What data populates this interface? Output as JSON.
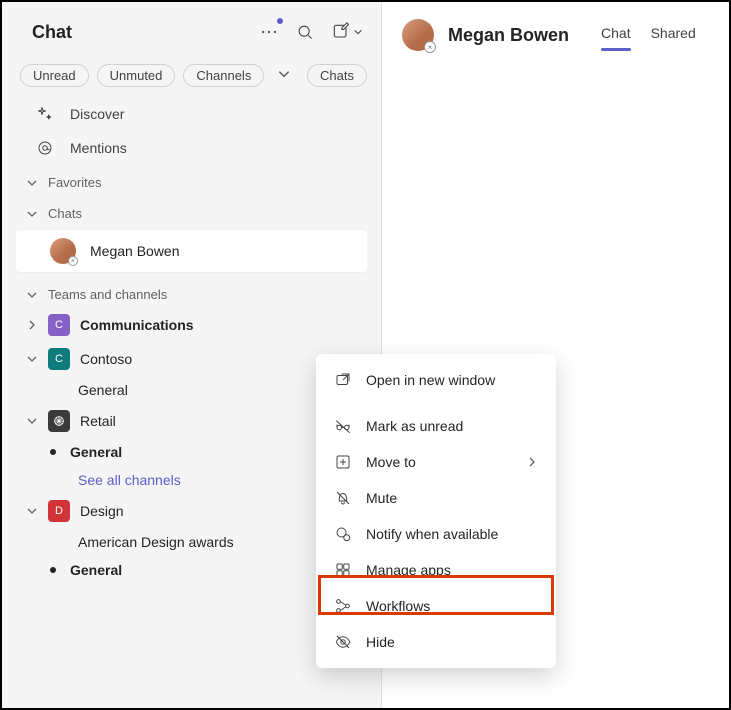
{
  "sidebar": {
    "title": "Chat",
    "filters": [
      "Unread",
      "Unmuted",
      "Channels",
      "Chats"
    ],
    "nav": [
      {
        "label": "Discover",
        "icon": "sparkle-icon"
      },
      {
        "label": "Mentions",
        "icon": "at-icon"
      }
    ],
    "sections": {
      "favorites": "Favorites",
      "chats": "Chats",
      "teams": "Teams and channels"
    },
    "active_chat": {
      "name": "Megan Bowen"
    },
    "teams": [
      {
        "name": "Communications",
        "color": "purple",
        "letter": "C",
        "expanded": false,
        "bold": true
      },
      {
        "name": "Contoso",
        "color": "teal",
        "letter": "C",
        "expanded": true,
        "channels": [
          {
            "label": "General",
            "bold": false,
            "bullet": false
          }
        ]
      },
      {
        "name": "Retail",
        "color": "dark",
        "letter": "",
        "expanded": true,
        "channels": [
          {
            "label": "General",
            "bold": true,
            "bullet": true
          },
          {
            "label": "See all channels",
            "link": true
          }
        ]
      },
      {
        "name": "Design",
        "color": "red",
        "letter": "D",
        "expanded": true,
        "channels": [
          {
            "label": "American Design awards",
            "bold": false
          },
          {
            "label": "General",
            "bold": true,
            "bullet": true
          }
        ]
      }
    ]
  },
  "main": {
    "name": "Megan Bowen",
    "tabs": [
      "Chat",
      "Shared"
    ],
    "active_tab": 0
  },
  "context_menu": {
    "items": [
      {
        "label": "Open in new window",
        "icon": "open-window-icon"
      },
      {
        "label": "Mark as unread",
        "icon": "glasses-off-icon"
      },
      {
        "label": "Move to",
        "icon": "move-icon",
        "submenu": true
      },
      {
        "label": "Mute",
        "icon": "bell-off-icon"
      },
      {
        "label": "Notify when available",
        "icon": "presence-icon"
      },
      {
        "label": "Manage apps",
        "icon": "apps-icon",
        "highlighted": true
      },
      {
        "label": "Workflows",
        "icon": "workflow-icon"
      },
      {
        "label": "Hide",
        "icon": "eye-off-icon"
      }
    ]
  }
}
